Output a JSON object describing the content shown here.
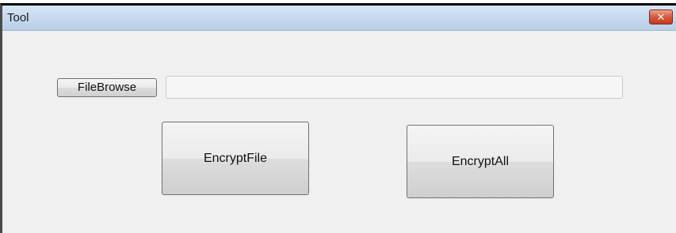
{
  "window": {
    "title": "Tool",
    "close_label": "✕"
  },
  "form": {
    "browse_label": "FileBrowse",
    "path_value": "",
    "encrypt_file_label": "EncryptFile",
    "encrypt_all_label": "EncryptAll"
  }
}
